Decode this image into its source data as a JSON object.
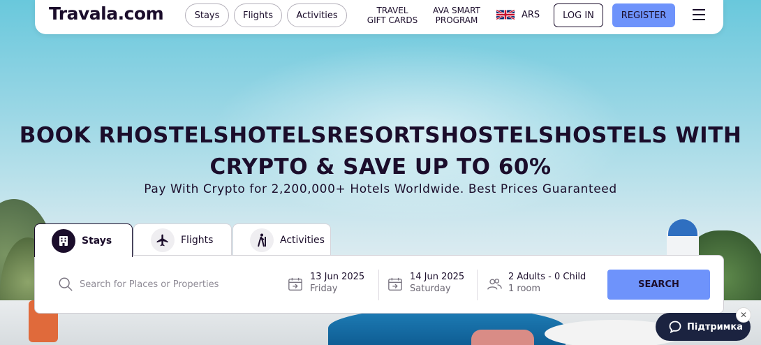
{
  "colors": {
    "brand_dark": "#1b0d2b",
    "accent": "#6e93fb",
    "support_bg": "#1b2340"
  },
  "nav": {
    "logo": "Travala.com",
    "pills": [
      {
        "label": "Stays"
      },
      {
        "label": "Flights"
      },
      {
        "label": "Activities"
      }
    ],
    "gift_cards": [
      "TRAVEL",
      "GIFT CARDS"
    ],
    "ava_program": [
      "AVA SMART",
      "PROGRAM"
    ],
    "language_icon": "uk-flag-icon",
    "currency": "ARS",
    "login_label": "LOG IN",
    "register_label": "REGISTER",
    "menu_icon": "hamburger-menu-icon"
  },
  "hero": {
    "title_line1": "BOOK RHOSTELSHOTELSRESORTSHOSTELSHOSTELS WITH",
    "title_line2": "CRYPTO & SAVE UP TO 60%",
    "subtitle": "Pay With Crypto for 2,200,000+ Hotels Worldwide. Best Prices Guaranteed"
  },
  "search": {
    "tabs": [
      {
        "label": "Stays",
        "icon": "building-icon",
        "active": true
      },
      {
        "label": "Flights",
        "icon": "airplane-icon",
        "active": false
      },
      {
        "label": "Activities",
        "icon": "hiker-icon",
        "active": false
      }
    ],
    "place_placeholder": "Search for Places or Properties",
    "checkin": {
      "date": "13 Jun 2025",
      "day": "Friday"
    },
    "checkout": {
      "date": "14 Jun 2025",
      "day": "Saturday"
    },
    "guests": {
      "summary": "2 Adults - 0 Child",
      "rooms": "1 room"
    },
    "search_label": "SEARCH"
  },
  "support": {
    "label": "Підтримка",
    "close": "✕"
  }
}
